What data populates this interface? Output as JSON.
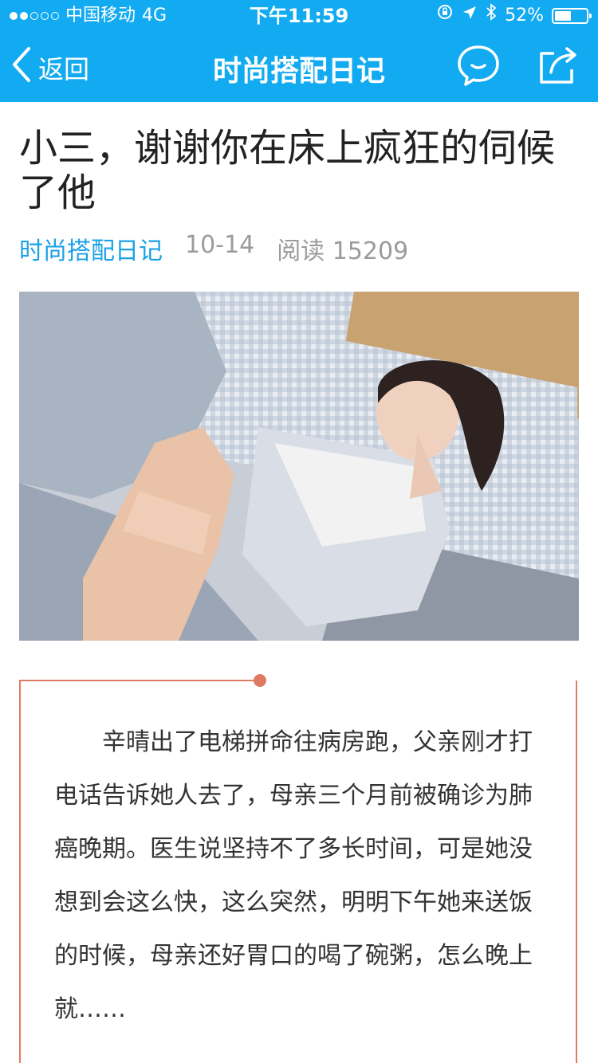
{
  "status_bar": {
    "carrier": "中国移动",
    "network": "4G",
    "time": "下午11:59",
    "battery_text": "52%",
    "battery_level": 0.52
  },
  "nav": {
    "back_label": "返回",
    "title": "时尚搭配日记",
    "icons": [
      "chat-bubble-icon",
      "share-icon"
    ]
  },
  "article": {
    "title": "小三，谢谢你在床上疯狂的伺候了他",
    "source": "时尚搭配日记",
    "date": "10-14",
    "reads": "阅读 15209",
    "paragraph": "辛晴出了电梯拼命往病房跑，父亲刚才打电话告诉她人去了，母亲三个月前被确诊为肺癌晚期。医生说坚持不了多长时间，可是她没想到会这么快，这么突然，明明下午她来送饭的时候，母亲还好胃口的喝了碗粥，怎么晚上就……"
  },
  "colors": {
    "header": "#12aaf0",
    "accent": "#1aa1e6",
    "card_border": "#e07a63"
  }
}
